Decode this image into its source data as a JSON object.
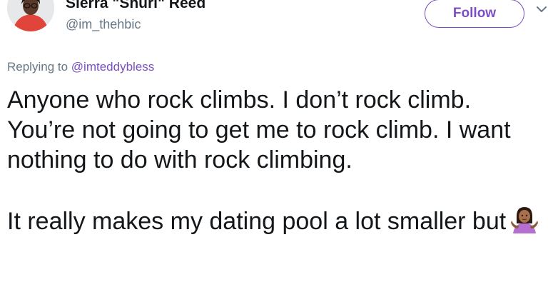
{
  "author": {
    "display_name": "Sierra \"Shuri\" Reed",
    "handle": "@im_thehbic"
  },
  "follow_button": {
    "label": "Follow"
  },
  "reply": {
    "prefix": "Replying to",
    "mention": "@imteddybless"
  },
  "tweet": {
    "paragraph1": "Anyone who rock climbs. I don’t rock climb. You’re not going to get me to rock climb. I want nothing to do with rock climbing.",
    "paragraph2": "It really makes my dating pool a lot smaller but"
  },
  "icons": {
    "avatar": "profile-photo",
    "emoji": "person-shrugging-emoji",
    "menu": "chevron-down-icon"
  },
  "colors": {
    "accent": "#7b4ec5",
    "secondary_text": "#657786",
    "primary_text": "#14171a"
  }
}
